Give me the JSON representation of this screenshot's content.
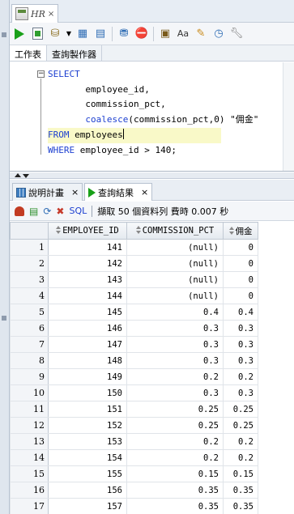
{
  "editor_tab": {
    "title": "HR",
    "close": "×"
  },
  "subtabs": [
    {
      "label": "工作表"
    },
    {
      "label": "查詢製作器"
    }
  ],
  "code": {
    "select": "SELECT",
    "line2": "employee_id,",
    "line3": "commission_pct,",
    "fn": "coalesce",
    "args": "(commission_pct,0) \"佣金\"",
    "from": "FROM",
    "from_table": "employees",
    "where": "WHERE",
    "where_cond": "employee_id > 140;"
  },
  "result_tabs": [
    {
      "label": "說明計畫",
      "close": "×"
    },
    {
      "label": "查詢結果",
      "close": "×"
    }
  ],
  "result_toolbar": {
    "sql_label": "SQL",
    "status": "擷取 50 個資料列 費時 0.007 秒"
  },
  "grid": {
    "columns": [
      "EMPLOYEE_ID",
      "COMMISSION_PCT",
      "佣金"
    ],
    "rows": [
      {
        "n": "1",
        "id": "141",
        "pct": "(null)",
        "yj": "0"
      },
      {
        "n": "2",
        "id": "142",
        "pct": "(null)",
        "yj": "0"
      },
      {
        "n": "3",
        "id": "143",
        "pct": "(null)",
        "yj": "0"
      },
      {
        "n": "4",
        "id": "144",
        "pct": "(null)",
        "yj": "0"
      },
      {
        "n": "5",
        "id": "145",
        "pct": "0.4",
        "yj": "0.4"
      },
      {
        "n": "6",
        "id": "146",
        "pct": "0.3",
        "yj": "0.3"
      },
      {
        "n": "7",
        "id": "147",
        "pct": "0.3",
        "yj": "0.3"
      },
      {
        "n": "8",
        "id": "148",
        "pct": "0.3",
        "yj": "0.3"
      },
      {
        "n": "9",
        "id": "149",
        "pct": "0.2",
        "yj": "0.2"
      },
      {
        "n": "10",
        "id": "150",
        "pct": "0.3",
        "yj": "0.3"
      },
      {
        "n": "11",
        "id": "151",
        "pct": "0.25",
        "yj": "0.25"
      },
      {
        "n": "12",
        "id": "152",
        "pct": "0.25",
        "yj": "0.25"
      },
      {
        "n": "13",
        "id": "153",
        "pct": "0.2",
        "yj": "0.2"
      },
      {
        "n": "14",
        "id": "154",
        "pct": "0.2",
        "yj": "0.2"
      },
      {
        "n": "15",
        "id": "155",
        "pct": "0.15",
        "yj": "0.15"
      },
      {
        "n": "16",
        "id": "156",
        "pct": "0.35",
        "yj": "0.35"
      },
      {
        "n": "17",
        "id": "157",
        "pct": "0.35",
        "yj": "0.35"
      }
    ]
  }
}
